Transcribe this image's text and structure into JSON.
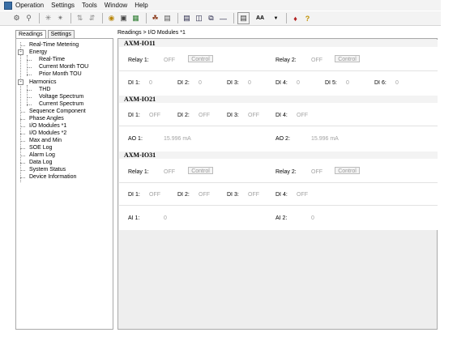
{
  "menu": [
    "Operation",
    "Settings",
    "Tools",
    "Window",
    "Help"
  ],
  "toolbar": {
    "text_size_label": "AA"
  },
  "tabs": {
    "readings": "Readings",
    "settings": "Settings"
  },
  "breadcrumb": "Readings > I/O Modules *1",
  "tree": {
    "real_time_metering": "Real-Time Metering",
    "energy": "Energy",
    "energy_real_time": "Real-Time",
    "current_month_tou": "Current Month TOU",
    "prior_month_tou": "Prior Month TOU",
    "harmonics": "Harmonics",
    "thd": "THD",
    "voltage_spectrum": "Voltage Spectrum",
    "current_spectrum": "Current Spectrum",
    "sequence_component": "Sequence Component",
    "phase_angles": "Phase Angles",
    "io_modules_1": "I/O Modules *1",
    "io_modules_2": "I/O Modules *2",
    "max_and_min": "Max and Min",
    "soe_log": "SOE Log",
    "alarm_log": "Alarm Log",
    "data_log": "Data Log",
    "system_status": "System Status",
    "device_information": "Device Information"
  },
  "axm_io11": {
    "title": "AXM-IO11",
    "relay1_label": "Relay 1:",
    "relay1_value": "OFF",
    "relay2_label": "Relay 2:",
    "relay2_value": "OFF",
    "control_label": "Control",
    "di": [
      {
        "label": "DI 1:",
        "value": "0"
      },
      {
        "label": "DI 2:",
        "value": "0"
      },
      {
        "label": "DI 3:",
        "value": "0"
      },
      {
        "label": "DI 4:",
        "value": "0"
      },
      {
        "label": "DI 5:",
        "value": "0"
      },
      {
        "label": "DI 6:",
        "value": "0"
      }
    ]
  },
  "axm_io21": {
    "title": "AXM-IO21",
    "di": [
      {
        "label": "DI 1:",
        "value": "OFF"
      },
      {
        "label": "DI 2:",
        "value": "OFF"
      },
      {
        "label": "DI 3:",
        "value": "OFF"
      },
      {
        "label": "DI 4:",
        "value": "OFF"
      }
    ],
    "ao1_label": "AO 1:",
    "ao1_value": "15.996 mA",
    "ao2_label": "AO 2:",
    "ao2_value": "15.996 mA"
  },
  "axm_io31": {
    "title": "AXM-IO31",
    "relay1_label": "Relay 1:",
    "relay1_value": "OFF",
    "relay2_label": "Relay 2:",
    "relay2_value": "OFF",
    "control_label": "Control",
    "di": [
      {
        "label": "DI 1:",
        "value": "OFF"
      },
      {
        "label": "DI 2:",
        "value": "OFF"
      },
      {
        "label": "DI 3:",
        "value": "OFF"
      },
      {
        "label": "DI 4:",
        "value": "OFF"
      }
    ],
    "ai1_label": "AI 1:",
    "ai1_value": "0",
    "ai2_label": "AI 2:",
    "ai2_value": "0"
  }
}
